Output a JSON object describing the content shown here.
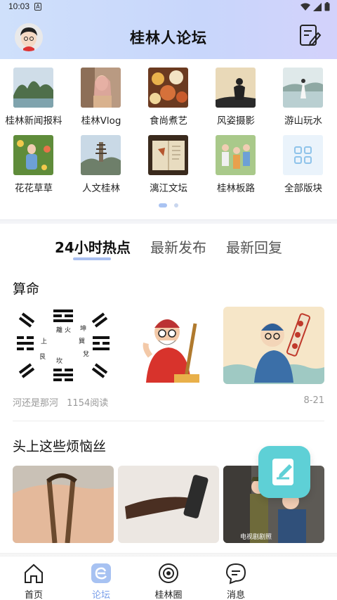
{
  "status": {
    "time": "10:03",
    "notif": "A"
  },
  "header": {
    "title": "桂林人论坛"
  },
  "boards": [
    {
      "label": "桂林新闻报料",
      "icon": "karst-river-photo"
    },
    {
      "label": "桂林Vlog",
      "icon": "girl-portrait-photo"
    },
    {
      "label": "食尚煮艺",
      "icon": "food-platter-photo"
    },
    {
      "label": "风姿摄影",
      "icon": "silhouette-photo"
    },
    {
      "label": "游山玩水",
      "icon": "lakeside-photo"
    },
    {
      "label": "花花草草",
      "icon": "child-flowers-photo"
    },
    {
      "label": "人文桂林",
      "icon": "pagoda-photo"
    },
    {
      "label": "漓江文坛",
      "icon": "book-leaf-photo"
    },
    {
      "label": "桂林板路",
      "icon": "group-photo"
    },
    {
      "label": "全部版块",
      "icon": "grid-icon"
    }
  ],
  "tabs": [
    {
      "label": "24小时热点",
      "active": true
    },
    {
      "label": "最新发布",
      "active": false
    },
    {
      "label": "最新回复",
      "active": false
    }
  ],
  "posts": [
    {
      "title": "算命",
      "author": "河还是那河",
      "reads": "1154阅读",
      "date": "8-21",
      "images": [
        "bagua-diagram",
        "fortune-teller-cartoon",
        "fortune-teller-scroll-cartoon"
      ],
      "bagua_chars": [
        "離",
        "火",
        "上",
        "巽",
        "坤",
        "兌",
        "坎",
        "艮"
      ]
    },
    {
      "title": "头上这些烦恼丝",
      "images": [
        "old-scissors-photo",
        "straight-razor-photo",
        "tv-drama-photo"
      ],
      "watermark": "电视剧剧照"
    }
  ],
  "bottom_nav": [
    {
      "label": "首页",
      "icon": "home-icon",
      "active": false
    },
    {
      "label": "论坛",
      "icon": "forum-icon",
      "active": true
    },
    {
      "label": "桂林圈",
      "icon": "circle-eye-icon",
      "active": false
    },
    {
      "label": "消息",
      "icon": "message-icon",
      "active": false
    }
  ],
  "colors": {
    "accent": "#7ba0ea",
    "fab": "#5ed0d6",
    "header": "#c8d6fb"
  }
}
